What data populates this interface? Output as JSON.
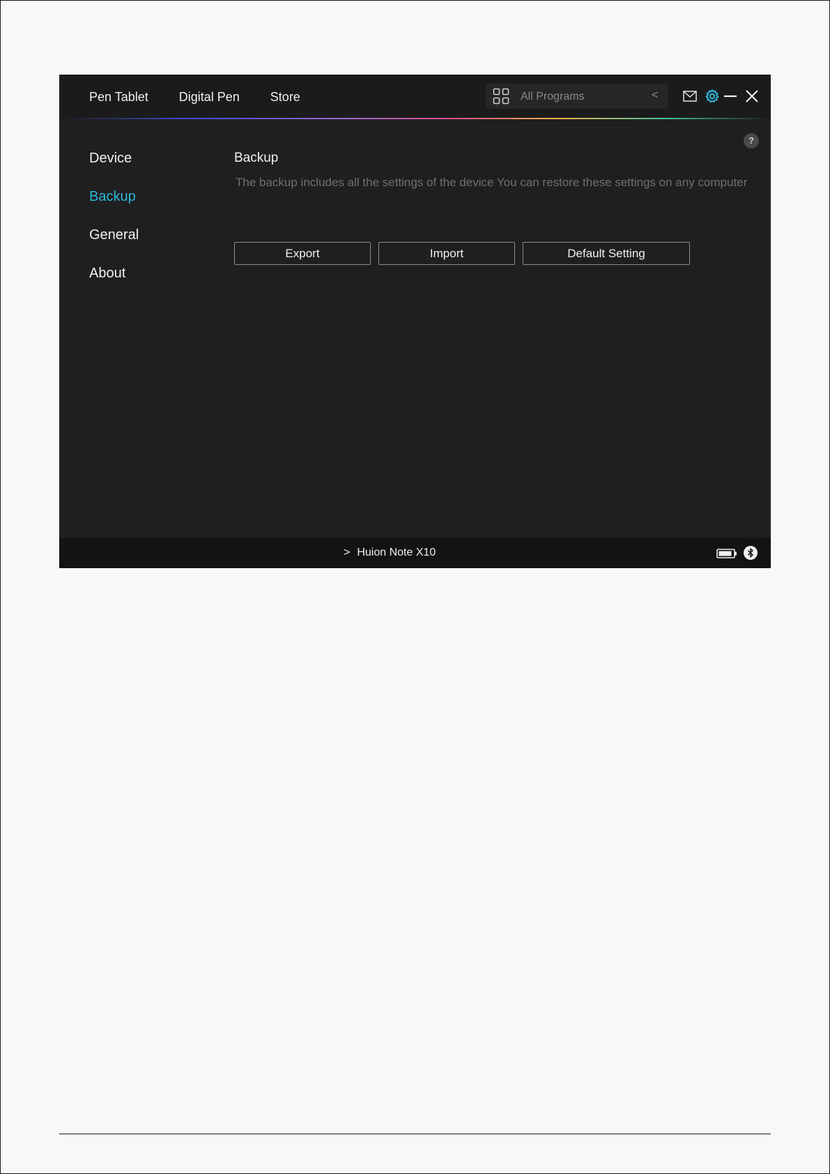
{
  "topbar": {
    "nav": [
      "Pen Tablet",
      "Digital Pen",
      "Store"
    ],
    "program_select": {
      "value": "All Programs",
      "chevron": "<"
    }
  },
  "sidebar": {
    "items": [
      {
        "label": "Device",
        "active": false
      },
      {
        "label": "Backup",
        "active": true
      },
      {
        "label": "General",
        "active": false
      },
      {
        "label": "About",
        "active": false
      }
    ]
  },
  "help": {
    "label": "?"
  },
  "content": {
    "title": "Backup",
    "description": "The backup includes all the settings of the device You can restore these settings  on any computer",
    "buttons": {
      "export": "Export",
      "import": "Import",
      "default": "Default Setting"
    }
  },
  "statusbar": {
    "arrow": ">",
    "device_name": "Huion Note X10"
  },
  "colors": {
    "accent": "#2db7d9",
    "background": "#1f1f1f",
    "topbar": "#1b1b1b",
    "statusbar": "#131313"
  },
  "icons": {
    "programs": "grid-icon",
    "mail": "mail-icon",
    "settings": "gear-icon",
    "minimize": "minimize-icon",
    "close": "close-icon",
    "battery": "battery-icon",
    "bluetooth": "bluetooth-icon"
  }
}
